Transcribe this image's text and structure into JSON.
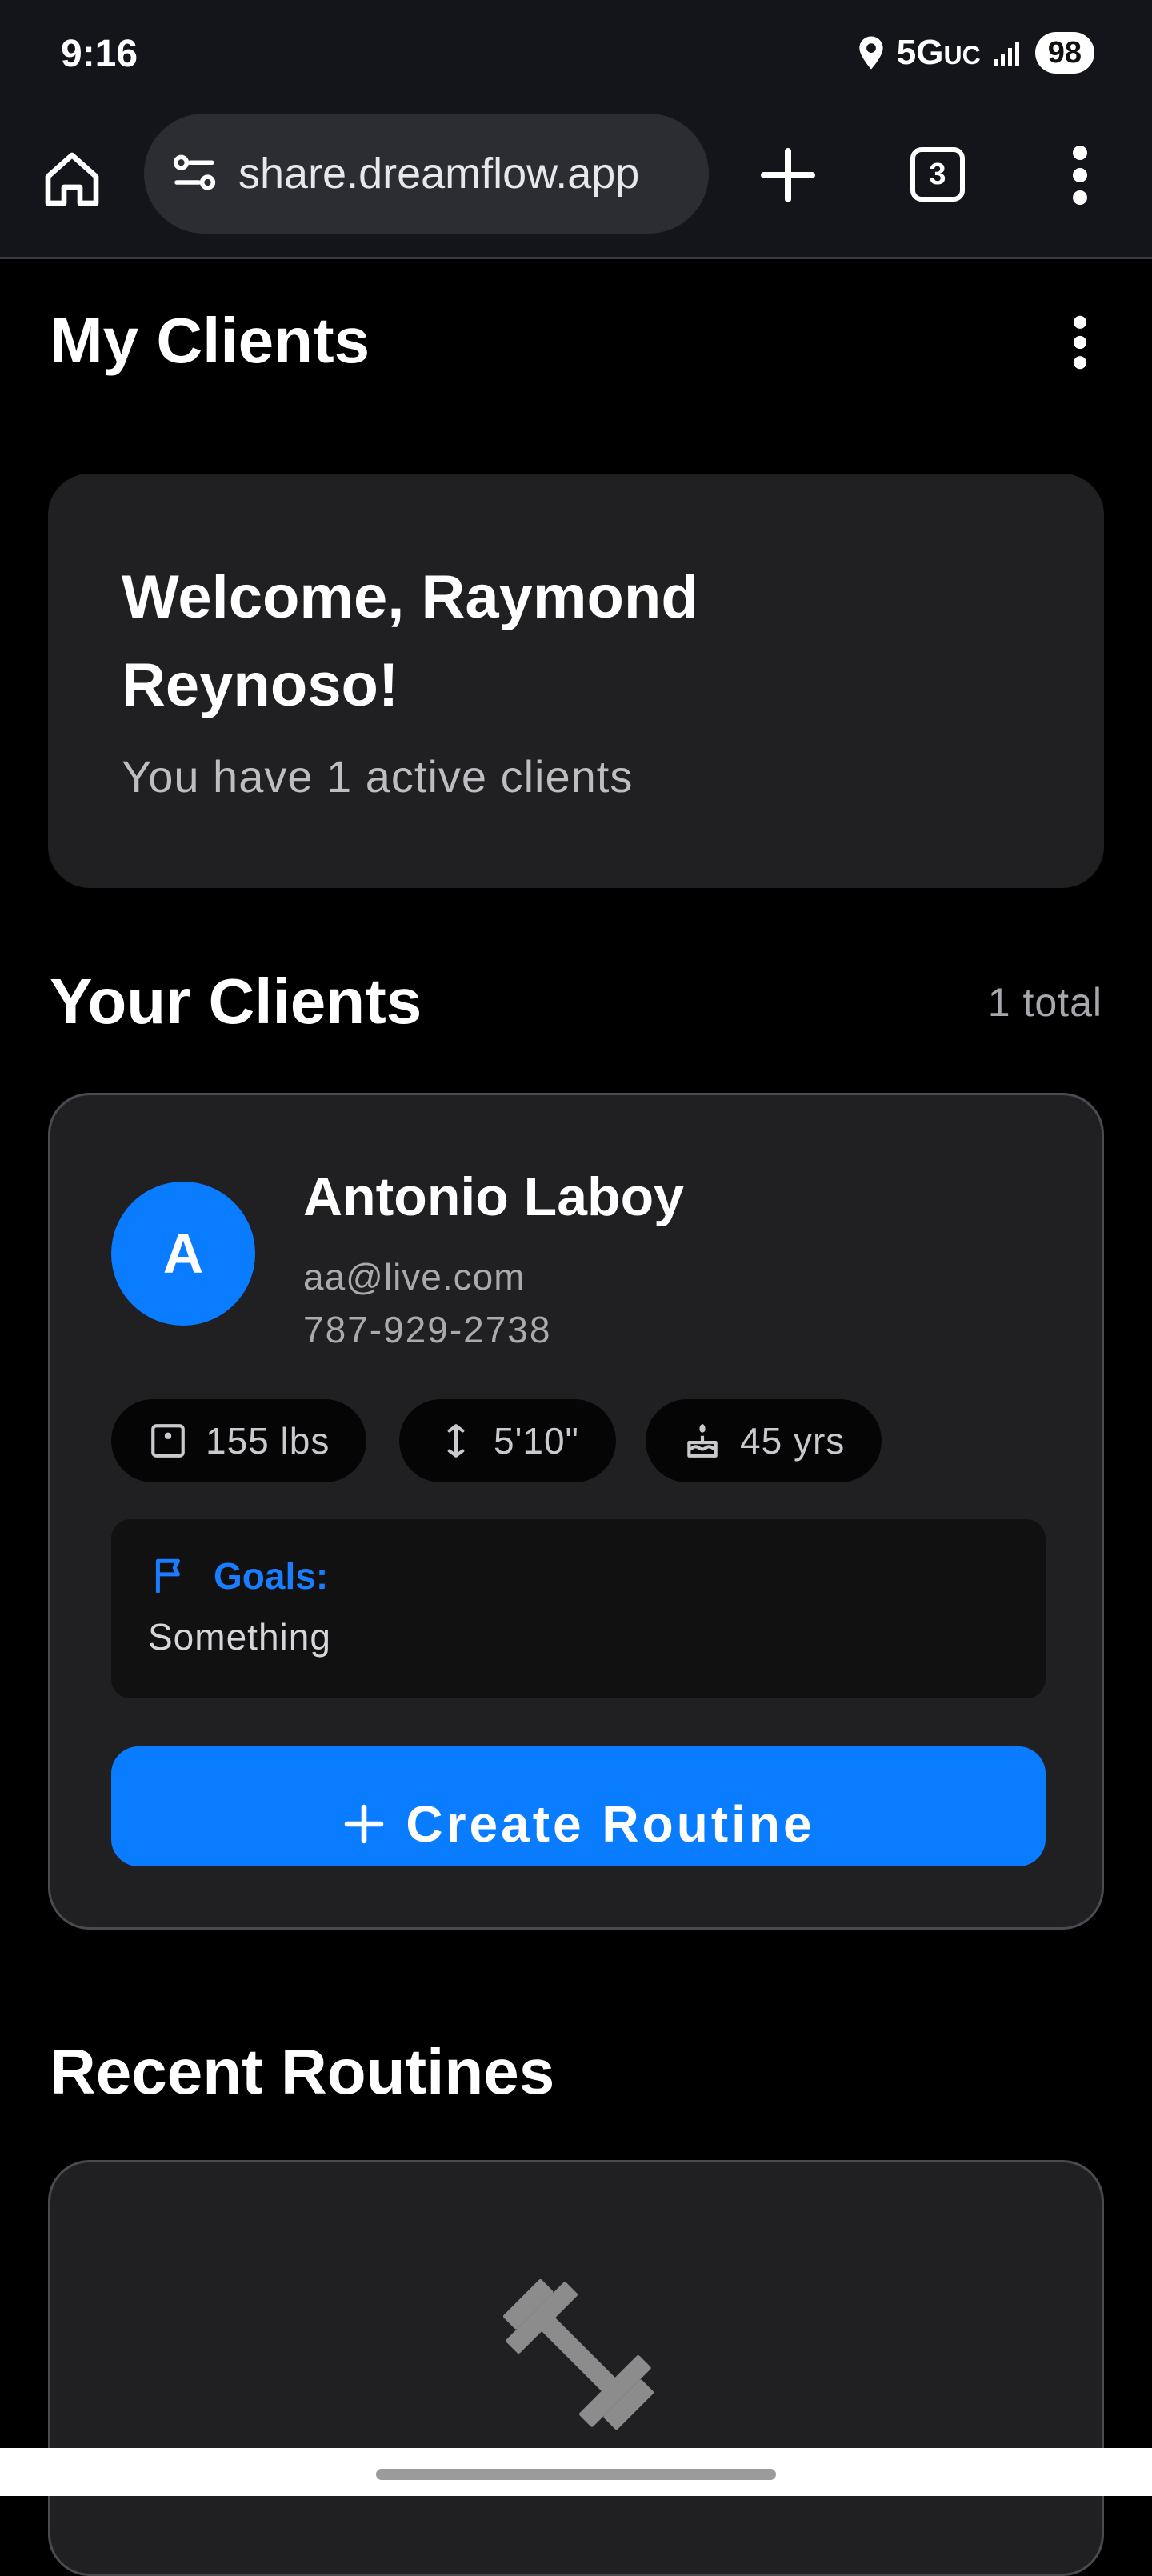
{
  "status_bar": {
    "time": "9:16",
    "network": "5G",
    "network_suffix": "UC",
    "battery": "98"
  },
  "browser": {
    "url": "share.dreamflow.app",
    "tab_count": "3"
  },
  "page": {
    "title": "My Clients"
  },
  "welcome": {
    "title": "Welcome, Raymond Reynoso!",
    "subtitle": "You have 1 active clients"
  },
  "clients_section": {
    "title": "Your Clients",
    "total": "1 total",
    "clients": [
      {
        "initial": "A",
        "name": "Antonio Laboy",
        "email": "aa@live.com",
        "phone": "787-929-2738",
        "weight": "155 lbs",
        "height": "5'10\"",
        "age": "45 yrs",
        "goals_label": "Goals:",
        "goals": "Something",
        "create_button_label": "Create Routine"
      }
    ]
  },
  "routines_section": {
    "title": "Recent Routines",
    "empty_icon": "dumbbell-icon"
  },
  "colors": {
    "accent": "#0a7cff",
    "background": "#000000",
    "card": "#202022"
  }
}
